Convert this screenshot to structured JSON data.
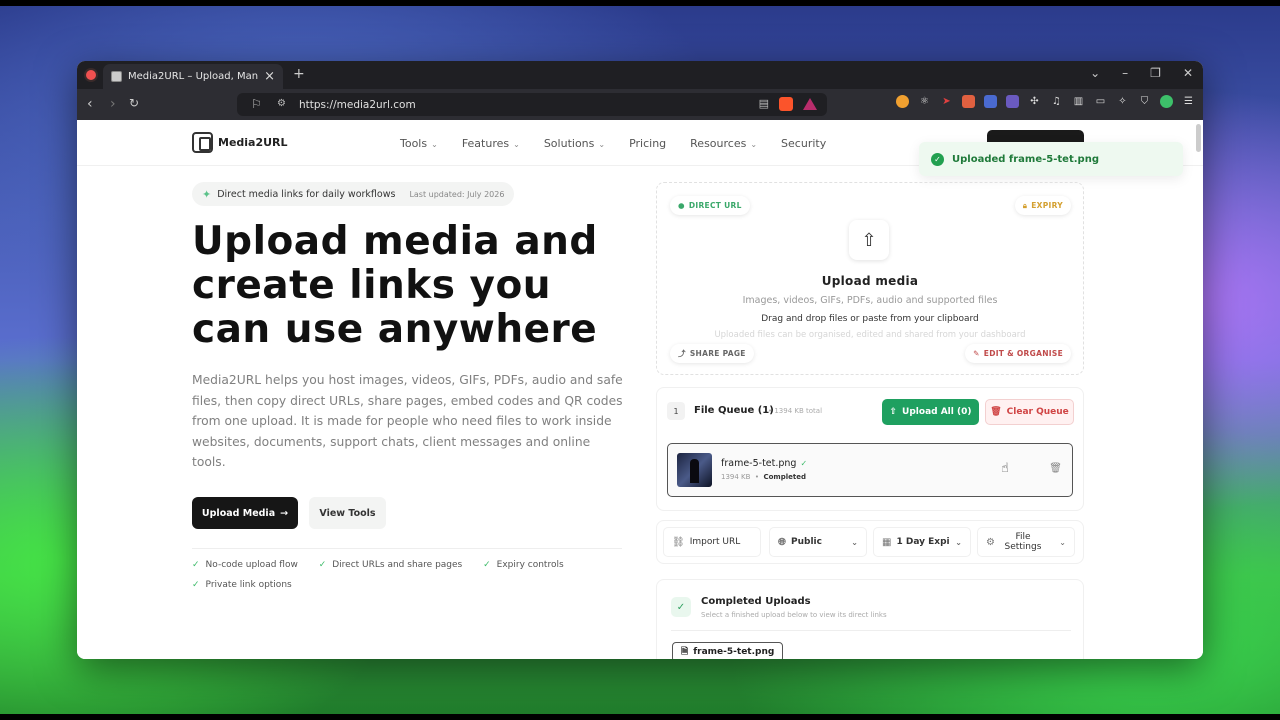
{
  "browser": {
    "tab_title": "Media2URL – Upload, Manage a",
    "url": "https://media2url.com",
    "new_tab": "+",
    "close_tab": "×"
  },
  "site": {
    "logo_text": "Media2URL",
    "menu": [
      {
        "label": "Tools",
        "has_caret": true
      },
      {
        "label": "Features",
        "has_caret": true
      },
      {
        "label": "Solutions",
        "has_caret": true
      },
      {
        "label": "Pricing",
        "has_caret": false
      },
      {
        "label": "Resources",
        "has_caret": true
      },
      {
        "label": "Security",
        "has_caret": false
      }
    ]
  },
  "toast": {
    "text": "Uploaded frame-5-tet.png"
  },
  "hero": {
    "badge": "Direct media links for daily workflows",
    "updated": "Last updated: July 2026",
    "title": "Upload media and create links you can use anywhere",
    "description": "Media2URL helps you host images, videos, GIFs, PDFs, audio and safe files, then copy direct URLs, share pages, embed codes and QR codes from one upload. It is made for people who need files to work inside websites, documents, support chats, client messages and online tools.",
    "primary_button": "Upload Media",
    "secondary_button": "View Tools",
    "features": [
      "No-code upload flow",
      "Direct URLs and share pages",
      "Expiry controls",
      "Private link options"
    ]
  },
  "dropzone": {
    "chip_direct": "DIRECT URL",
    "chip_expiry": "EXPIRY",
    "chip_share": "SHARE PAGE",
    "chip_edit": "EDIT & ORGANISE",
    "title": "Upload media",
    "subtitle": "Images, videos, GIFs, PDFs, audio and supported files",
    "drag_text": "Drag and drop files or paste from your clipboard",
    "faint_text": "Uploaded files can be organised, edited and shared from your dashboard"
  },
  "queue": {
    "count": "1",
    "title": "File Queue (1)",
    "total": "• 1394 KB total",
    "upload_all": "Upload All (0)",
    "clear": "Clear Queue",
    "item": {
      "name": "frame-5-tet.png",
      "size": "1394 KB",
      "status": "Completed"
    }
  },
  "options": {
    "import_url": "Import URL",
    "visibility": "Public",
    "expiry": "1 Day Expi",
    "file_settings": "File Settings"
  },
  "completed": {
    "title": "Completed Uploads",
    "subtitle": "Select a finished upload below to view its direct links",
    "file": "frame-5-tet.png"
  },
  "colors": {
    "accent_green": "#1fa060",
    "danger": "#d04545",
    "dark": "#161616"
  }
}
